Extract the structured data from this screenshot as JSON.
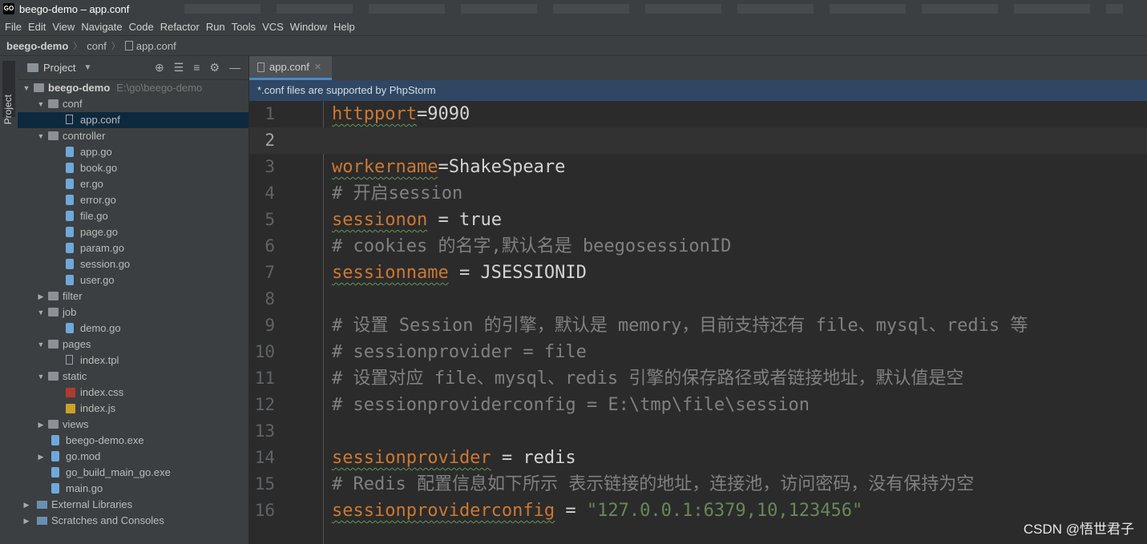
{
  "window": {
    "title": "beego-demo – app.conf"
  },
  "menu": [
    "File",
    "Edit",
    "View",
    "Navigate",
    "Code",
    "Refactor",
    "Run",
    "Tools",
    "VCS",
    "Window",
    "Help"
  ],
  "breadcrumb": [
    "beego-demo",
    "conf",
    "app.conf"
  ],
  "side_stripe": {
    "label": "Project"
  },
  "project_panel": {
    "title": "Project",
    "tree": [
      {
        "label": "beego-demo",
        "path": "E:\\go\\beego-demo",
        "type": "folder",
        "depth": 0,
        "expanded": true,
        "bold": true
      },
      {
        "label": "conf",
        "type": "folder",
        "depth": 1,
        "expanded": true
      },
      {
        "label": "app.conf",
        "type": "file",
        "depth": 2,
        "selected": true
      },
      {
        "label": "controller",
        "type": "folder",
        "depth": 1,
        "expanded": true
      },
      {
        "label": "app.go",
        "type": "go",
        "depth": 2
      },
      {
        "label": "book.go",
        "type": "go",
        "depth": 2
      },
      {
        "label": "er.go",
        "type": "go",
        "depth": 2
      },
      {
        "label": "error.go",
        "type": "go",
        "depth": 2
      },
      {
        "label": "file.go",
        "type": "go",
        "depth": 2
      },
      {
        "label": "page.go",
        "type": "go",
        "depth": 2
      },
      {
        "label": "param.go",
        "type": "go",
        "depth": 2
      },
      {
        "label": "session.go",
        "type": "go",
        "depth": 2
      },
      {
        "label": "user.go",
        "type": "go",
        "depth": 2
      },
      {
        "label": "filter",
        "type": "folder",
        "depth": 1,
        "expanded": false
      },
      {
        "label": "job",
        "type": "folder",
        "depth": 1,
        "expanded": true
      },
      {
        "label": "demo.go",
        "type": "go",
        "depth": 2
      },
      {
        "label": "pages",
        "type": "folder",
        "depth": 1,
        "expanded": true
      },
      {
        "label": "index.tpl",
        "type": "file",
        "depth": 2
      },
      {
        "label": "static",
        "type": "folder",
        "depth": 1,
        "expanded": true
      },
      {
        "label": "index.css",
        "type": "css",
        "depth": 2
      },
      {
        "label": "index.js",
        "type": "js",
        "depth": 2
      },
      {
        "label": "views",
        "type": "folder",
        "depth": 1,
        "expanded": false
      },
      {
        "label": "beego-demo.exe",
        "type": "go",
        "depth": 1
      },
      {
        "label": "go.mod",
        "type": "go",
        "depth": 1,
        "expanded": false
      },
      {
        "label": "go_build_main_go.exe",
        "type": "go",
        "depth": 1
      },
      {
        "label": "main.go",
        "type": "go",
        "depth": 1
      },
      {
        "label": "External Libraries",
        "type": "lib",
        "depth": 0,
        "expanded": false
      },
      {
        "label": "Scratches and Consoles",
        "type": "scratch",
        "depth": 0,
        "expanded": false
      }
    ]
  },
  "editor": {
    "tab": "app.conf",
    "banner": "*.conf files are supported by PhpStorm",
    "current_line": 2,
    "lines": [
      {
        "n": "1",
        "parts": [
          {
            "t": "httpport",
            "c": "key"
          },
          {
            "t": "=9090",
            "c": "val"
          }
        ]
      },
      {
        "n": "2",
        "parts": []
      },
      {
        "n": "3",
        "parts": [
          {
            "t": "workername",
            "c": "key"
          },
          {
            "t": "=ShakeSpeare",
            "c": "val"
          }
        ]
      },
      {
        "n": "4",
        "parts": [
          {
            "t": "# 开启session",
            "c": "cmt"
          }
        ]
      },
      {
        "n": "5",
        "parts": [
          {
            "t": "sessionon",
            "c": "key"
          },
          {
            "t": " = true",
            "c": "val"
          }
        ]
      },
      {
        "n": "6",
        "parts": [
          {
            "t": "# cookies 的名字,默认名是 beegosessionID",
            "c": "cmt"
          }
        ]
      },
      {
        "n": "7",
        "parts": [
          {
            "t": "sessionname",
            "c": "key"
          },
          {
            "t": " = JSESSIONID",
            "c": "val"
          }
        ]
      },
      {
        "n": "8",
        "parts": []
      },
      {
        "n": "9",
        "parts": [
          {
            "t": "# 设置 Session 的引擎，默认是 memory，目前支持还有 file、mysql、redis 等",
            "c": "cmt"
          }
        ]
      },
      {
        "n": "10",
        "parts": [
          {
            "t": "# sessionprovider = file",
            "c": "cmt"
          }
        ]
      },
      {
        "n": "11",
        "parts": [
          {
            "t": "# 设置对应 file、mysql、redis 引擎的保存路径或者链接地址，默认值是空",
            "c": "cmt"
          }
        ]
      },
      {
        "n": "12",
        "parts": [
          {
            "t": "# sessionproviderconfig = E:\\tmp\\file\\session",
            "c": "cmt"
          }
        ]
      },
      {
        "n": "13",
        "parts": []
      },
      {
        "n": "14",
        "parts": [
          {
            "t": "sessionprovider",
            "c": "key"
          },
          {
            "t": " = redis",
            "c": "val"
          }
        ]
      },
      {
        "n": "15",
        "parts": [
          {
            "t": "# Redis 配置信息如下所示 表示链接的地址，连接池，访问密码，没有保持为空",
            "c": "cmt"
          }
        ]
      },
      {
        "n": "16",
        "parts": [
          {
            "t": "sessionproviderconfig",
            "c": "key"
          },
          {
            "t": " = ",
            "c": "val"
          },
          {
            "t": "\"127.0.0.1:6379,10,123456\"",
            "c": "str"
          }
        ]
      }
    ]
  },
  "watermark": "CSDN @悟世君子"
}
